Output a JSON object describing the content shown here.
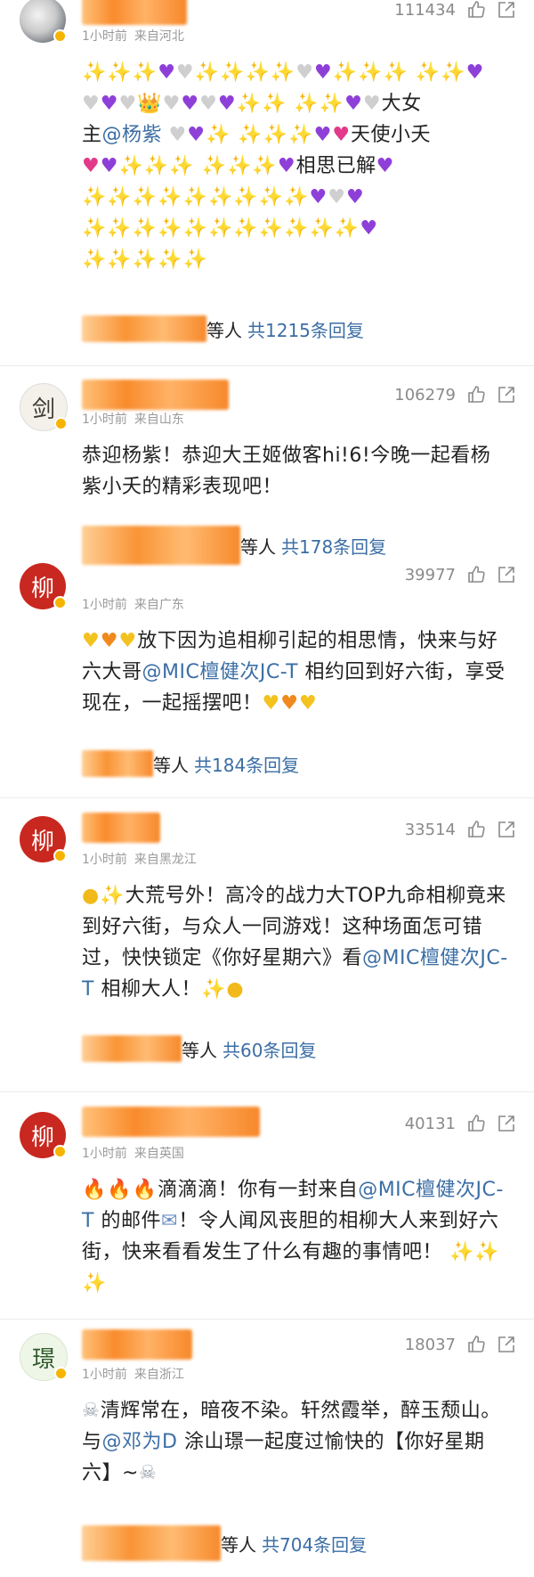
{
  "comments": [
    {
      "avatar_char": "",
      "likes": "111434",
      "meta": {
        "time": "1小时前",
        "location": "来自河北"
      },
      "text_a": "大女",
      "text_b": "主",
      "mention": "@杨紫",
      "text_c": "天使小夭",
      "text_d": "相思已解",
      "reply_people": "等人",
      "reply_total": "共1215条回复"
    },
    {
      "avatar_char": "剑",
      "likes": "106279",
      "meta": {
        "time": "1小时前",
        "location": "来自山东"
      },
      "text": "恭迎杨紫！恭迎大王姬做客hi!6!今晚一起看杨紫小夭的精彩表现吧！",
      "reply_people": "等人",
      "reply_total": "共178条回复"
    },
    {
      "avatar_char": "柳",
      "likes": "39977",
      "meta": {
        "time": "1小时前",
        "location": "来自广东"
      },
      "text_a": "放下因为追相柳引起的相思情，快来与好六大哥",
      "mention": "@MIC檀健次JC-T",
      "text_b": " 相约回到好六街，享受现在，一起摇摆吧！",
      "reply_people": "等人",
      "reply_total": "共184条回复"
    },
    {
      "avatar_char": "柳",
      "likes": "33514",
      "meta": {
        "time": "1小时前",
        "location": "来自黑龙江"
      },
      "text_a": "大荒号外！高冷的战力大TOP九命相柳竟来到好六街，与众人一同游戏！这种场面怎可错过，快快锁定《你好星期六》看",
      "mention": "@MIC檀健次JC-T",
      "text_b": " 相柳大人！",
      "reply_people": "等人",
      "reply_total": "共60条回复"
    },
    {
      "avatar_char": "柳",
      "likes": "40131",
      "meta": {
        "time": "1小时前",
        "location": "来自英国"
      },
      "text_a": "滴滴滴！你有一封来自",
      "mention": "@MIC檀健次JC-T",
      "text_b": " 的邮件",
      "text_c": "！令人闻风丧胆的相柳大人来到好六街，快来看看发生了什么有趣的事情吧！"
    },
    {
      "avatar_char": "璟",
      "likes": "18037",
      "meta": {
        "time": "1小时前",
        "location": "来自浙江"
      },
      "text_a": "清辉常在，暗夜不染。轩然霞举，醉玉颓山。与",
      "mention": "@邓为D",
      "text_b": " 涂山璟一起度过愉快的【你好星期六】~",
      "reply_people": "等人",
      "reply_total": "共704条回复"
    }
  ],
  "icons": {
    "like": "thumbs-up-icon",
    "share": "share-icon"
  },
  "colors": {
    "mention": "#3b6ea5",
    "meta": "#9a9a9a",
    "blur_orange": "#f98b2c"
  }
}
